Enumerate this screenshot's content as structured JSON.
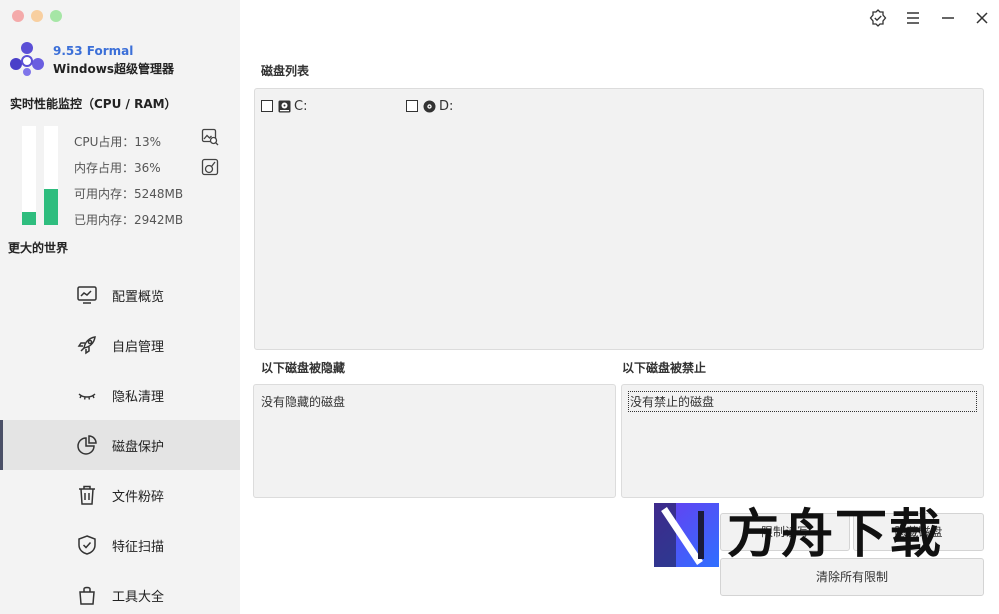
{
  "app": {
    "version": "9.53 Formal",
    "name": "Windows超级管理器"
  },
  "monitor": {
    "title": "实时性能监控（CPU / RAM）",
    "cpu_usage_percent": 13,
    "memory_usage_percent": 36,
    "cpu_label": "CPU占用：13%",
    "mem_label": "内存占用：36%",
    "avail_label": "可用内存：5248MB",
    "used_label": "已用内存：2942MB",
    "bar_color": "#2ebd7e"
  },
  "tagline": "更大的世界",
  "nav": {
    "items": [
      {
        "label": "配置概览",
        "icon": "monitor-chart-icon"
      },
      {
        "label": "自启管理",
        "icon": "rocket-icon"
      },
      {
        "label": "隐私清理",
        "icon": "closed-eye-icon"
      },
      {
        "label": "磁盘保护",
        "icon": "pie-chart-icon",
        "active": true
      },
      {
        "label": "文件粉碎",
        "icon": "trash-icon"
      },
      {
        "label": "特征扫描",
        "icon": "shield-check-icon"
      },
      {
        "label": "工具大全",
        "icon": "shopping-bag-icon"
      }
    ]
  },
  "disk_list": {
    "title": "磁盘列表",
    "disks": [
      {
        "label": "C:",
        "icon": "hard-drive-icon",
        "checked": false
      },
      {
        "label": "D:",
        "icon": "optical-disc-icon",
        "checked": false
      }
    ]
  },
  "hidden_panel": {
    "title": "以下磁盘被隐藏",
    "empty_text": "没有隐藏的磁盘"
  },
  "banned_panel": {
    "title": "以下磁盘被禁止",
    "empty_text": "没有禁止的磁盘"
  },
  "buttons": {
    "limit_read": "限制读写",
    "hide": "隐藏磁盘",
    "clear_all": "清除所有限制"
  },
  "watermark": {
    "text": "方舟下载"
  },
  "colors": {
    "accent_blue": "#3b6fd8",
    "active_nav": "#e4e4e4",
    "active_indicator": "#4a4f66"
  }
}
